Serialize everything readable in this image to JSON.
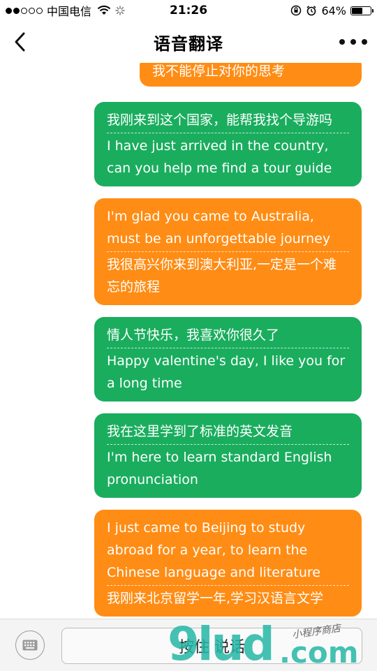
{
  "status_bar": {
    "carrier": "中国电信",
    "time": "21:26",
    "battery": "64%",
    "battery_level": 0.64
  },
  "nav": {
    "title": "语音翻译"
  },
  "messages": [
    {
      "color": "orange",
      "top_text": "我不能停止对你的思考",
      "bottom_text": ""
    },
    {
      "color": "green",
      "top_text": "我刚来到这个国家，能帮我找个导游吗",
      "bottom_text": "I have just arrived in the country, can you help me find a tour guide"
    },
    {
      "color": "orange",
      "top_text": "I'm glad you came to Australia, must be an unforgettable journey",
      "bottom_text": "我很高兴你来到澳大利亚,一定是一个难忘的旅程"
    },
    {
      "color": "green",
      "top_text": "情人节快乐，我喜欢你很久了",
      "bottom_text": "Happy valentine's day, I like you for a long time"
    },
    {
      "color": "green",
      "top_text": "我在这里学到了标准的英文发音",
      "bottom_text": "I'm here to learn standard English pronunciation"
    },
    {
      "color": "orange",
      "top_text": "I just came to Beijing to study abroad for a year, to learn the Chinese language and literature",
      "bottom_text": "我刚来北京留学一年,学习汉语言文学"
    }
  ],
  "input": {
    "talk_label": "按住 说话"
  },
  "watermark": {
    "big": "9lud",
    "dotcom": ".com",
    "small": "小程序商店"
  },
  "colors": {
    "green": "#1aad5e",
    "orange": "#ff8c14"
  }
}
